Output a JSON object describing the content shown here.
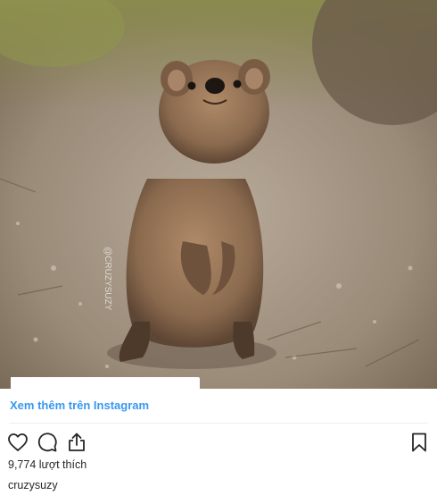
{
  "post": {
    "watermark": "@CRUZYSUZY",
    "view_more_label": "Xem thêm trên Instagram",
    "likes_text": "9,774 lượt thích",
    "username": "cruzysuzy"
  },
  "icons": {
    "like": "heart-icon",
    "comment": "comment-icon",
    "share": "share-icon",
    "save": "bookmark-icon"
  },
  "colors": {
    "link": "#3897f0",
    "text": "#262626",
    "divider": "#efefef"
  }
}
